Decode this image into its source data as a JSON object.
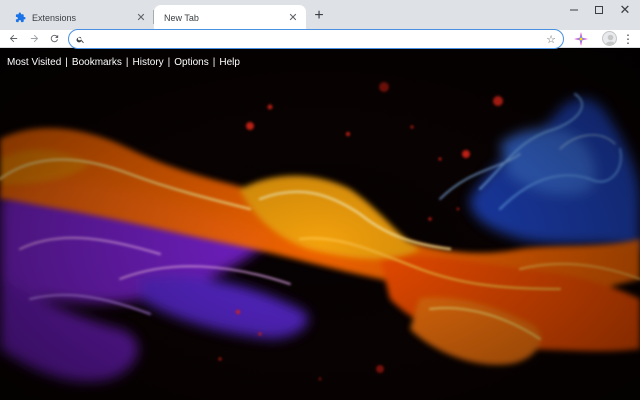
{
  "tabs": [
    {
      "title": "Extensions",
      "icon": "puzzle-icon",
      "active": false
    },
    {
      "title": "New Tab",
      "icon": null,
      "active": true
    }
  ],
  "omnibox": {
    "value": "",
    "placeholder": ""
  },
  "nav_links": [
    "Most Visited",
    "Bookmarks",
    "History",
    "Options",
    "Help"
  ],
  "nav_separator": "|",
  "background": {
    "description_colors": [
      "#ff7a00",
      "#ffb300",
      "#b32cff",
      "#2a6bff",
      "#e83b00"
    ]
  }
}
